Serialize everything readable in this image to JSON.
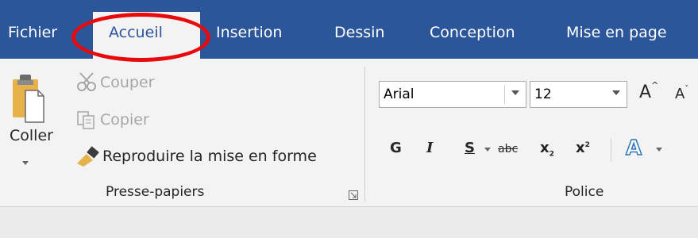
{
  "tabs": [
    {
      "label": "Fichier",
      "active": false
    },
    {
      "label": "Accueil",
      "active": true
    },
    {
      "label": "Insertion",
      "active": false
    },
    {
      "label": "Dessin",
      "active": false
    },
    {
      "label": "Conception",
      "active": false
    },
    {
      "label": "Mise en page",
      "active": false
    }
  ],
  "clipboard": {
    "paste_label": "Coller",
    "cut_label": "Couper",
    "copy_label": "Copier",
    "format_painter_label": "Reproduire la mise en forme",
    "group_label": "Presse-papiers"
  },
  "font": {
    "font_name": "Arial",
    "font_size": "12",
    "bold_label": "G",
    "italic_label": "I",
    "underline_label": "S",
    "strike_label": "abc",
    "subscript_label": "x",
    "subscript_suffix": "2",
    "superscript_label": "x",
    "superscript_suffix": "2",
    "grow_label": "A",
    "shrink_label": "A",
    "effects_label": "A",
    "group_label": "Police"
  },
  "colors": {
    "tab_bar": "#2b579a",
    "ribbon_bg": "#f3f3f3",
    "highlight_ellipse": "#e8090b"
  },
  "icons": [
    "paste-icon",
    "cut-icon",
    "copy-icon",
    "format-painter-icon",
    "dialog-launcher-icon",
    "text-effects-icon"
  ]
}
